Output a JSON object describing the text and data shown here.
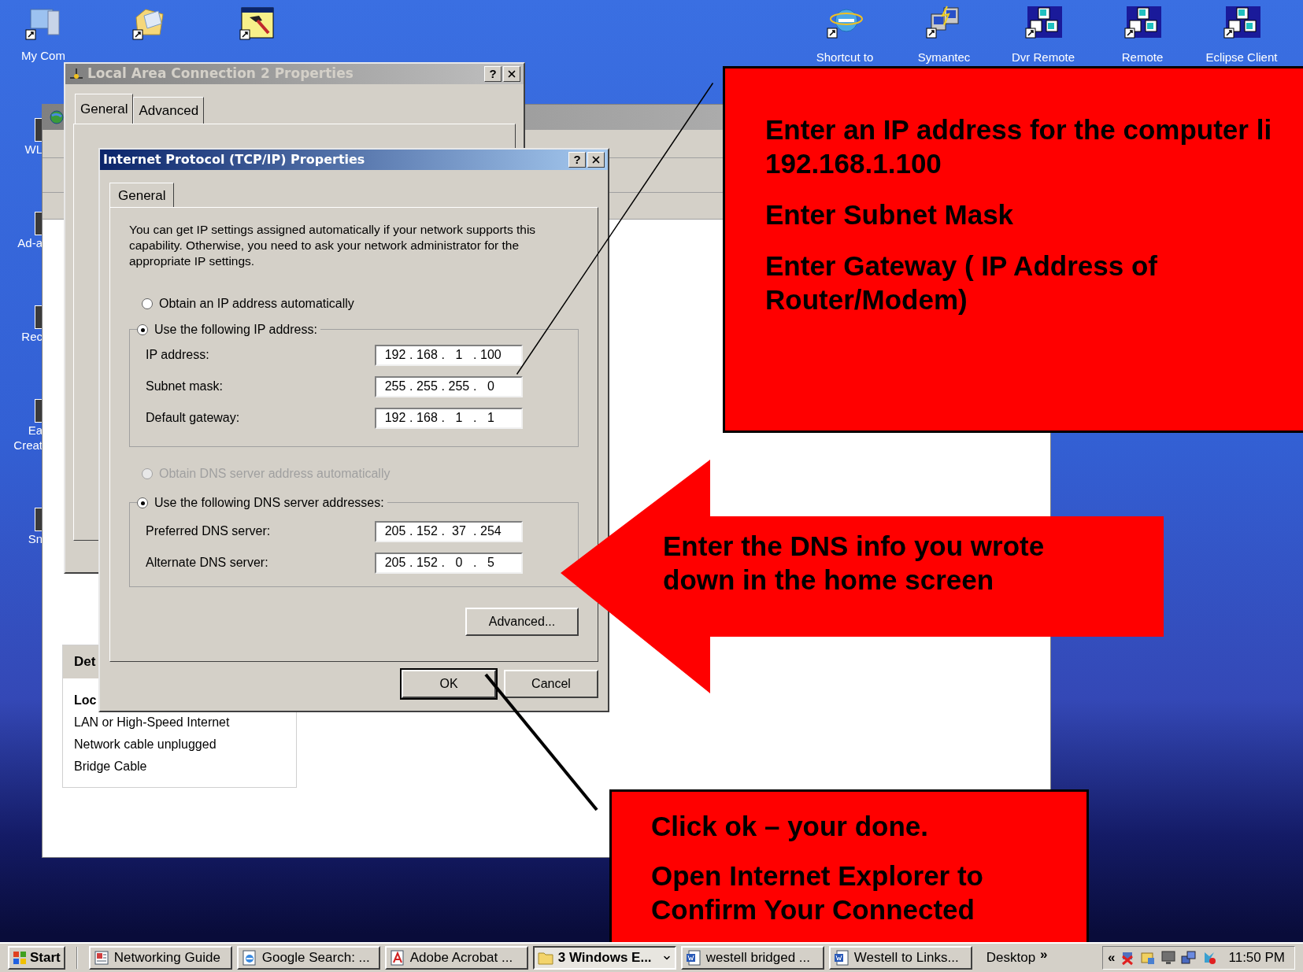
{
  "desktop_icons_top_left": [
    {
      "kind": "computer",
      "label": "My Com"
    },
    {
      "kind": "folder"
    },
    {
      "kind": "hammer"
    }
  ],
  "desktop_icons_left": [
    {
      "label": "WL"
    },
    {
      "label": "Ad-a"
    },
    {
      "label": "Rec"
    },
    {
      "label": "Ea\nCreat"
    },
    {
      "label": "Sn"
    }
  ],
  "desktop_icons_top_right": [
    {
      "kind": "browser",
      "label": "Shortcut to"
    },
    {
      "kind": "computers",
      "label": "Symantec"
    },
    {
      "kind": "cubes",
      "label": "Dvr Remote"
    },
    {
      "kind": "cubes",
      "label": "Remote"
    },
    {
      "kind": "cubes",
      "label": "Eclipse Client"
    }
  ],
  "back_window": {
    "details": {
      "header": "Det",
      "name": "Loc",
      "lines": [
        "LAN or High-Speed Internet",
        "Network cable unplugged",
        "Bridge Cable"
      ]
    }
  },
  "lan_window": {
    "title": "Local Area Connection 2 Properties",
    "help": "?",
    "tabs": [
      {
        "label": "General",
        "selected": true
      },
      {
        "label": "Advanced",
        "selected": false
      }
    ]
  },
  "tcpip_dialog": {
    "title": "Internet Protocol (TCP/IP) Properties",
    "help": "?",
    "tabs": [
      {
        "label": "General",
        "selected": true
      }
    ],
    "intro": "You can get IP settings assigned automatically if your network supports this capability. Otherwise, you need to ask your network administrator for the appropriate IP settings.",
    "ip_options": [
      {
        "label": "Obtain an IP address automatically",
        "selected": false,
        "disabled": false
      },
      {
        "label": "Use the following IP address:",
        "selected": true,
        "disabled": false
      }
    ],
    "ip_fields": [
      {
        "label": "IP address:",
        "octets": [
          "192",
          "168",
          "1",
          "100"
        ],
        "separator": "."
      },
      {
        "label": "Subnet mask:",
        "octets": [
          "255",
          "255",
          "255",
          "0"
        ],
        "separator": "."
      },
      {
        "label": "Default gateway:",
        "octets": [
          "192",
          "168",
          "1",
          "1"
        ],
        "separator": "."
      }
    ],
    "dns_options": [
      {
        "label": "Obtain DNS server address automatically",
        "selected": false,
        "disabled": true
      },
      {
        "label": "Use the following DNS server addresses:",
        "selected": true,
        "disabled": false
      }
    ],
    "dns_fields": [
      {
        "label": "Preferred DNS server:",
        "octets": [
          "205",
          "152",
          "37",
          "254"
        ],
        "separator": "."
      },
      {
        "label": "Alternate DNS server:",
        "octets": [
          "205",
          "152",
          "0",
          "5"
        ],
        "separator": "."
      }
    ],
    "advanced_button": "Advanced...",
    "buttons": [
      {
        "label": "OK",
        "default": true
      },
      {
        "label": "Cancel",
        "default": false
      }
    ]
  },
  "callouts": [
    {
      "kind": "box",
      "paragraphs": [
        [
          "Enter an IP address for the computer li",
          "192.168.1.100"
        ],
        [
          "Enter Subnet Mask"
        ],
        [
          "Enter Gateway ( IP Address of",
          "Router/Modem)"
        ]
      ]
    },
    {
      "kind": "arrow",
      "paragraphs": [
        [
          "Enter the DNS info you wrote",
          "down in the home screen"
        ]
      ]
    },
    {
      "kind": "box",
      "paragraphs": [
        [
          "Click ok – your done."
        ],
        [
          "Open Internet Explorer to",
          "Confirm Your Connected"
        ]
      ]
    }
  ],
  "taskbar": {
    "start": "Start",
    "tasks": [
      {
        "kind": "doc",
        "label": "Networking Guide",
        "selected": false,
        "group": false
      },
      {
        "kind": "browser",
        "label": "Google Search: ...",
        "selected": false,
        "group": false
      },
      {
        "kind": "pdf",
        "label": "Adobe Acrobat ...",
        "selected": false,
        "group": false
      },
      {
        "kind": "folder",
        "label": "3 Windows E...",
        "selected": true,
        "group": true
      },
      {
        "kind": "word",
        "label": "westell bridged ...",
        "selected": false,
        "group": false
      },
      {
        "kind": "word",
        "label": "Westell to Links...",
        "selected": false,
        "group": false
      }
    ],
    "desktop_toolbar": "Desktop",
    "more": "»",
    "tray_expand": "«",
    "clock": "11:50 PM"
  }
}
